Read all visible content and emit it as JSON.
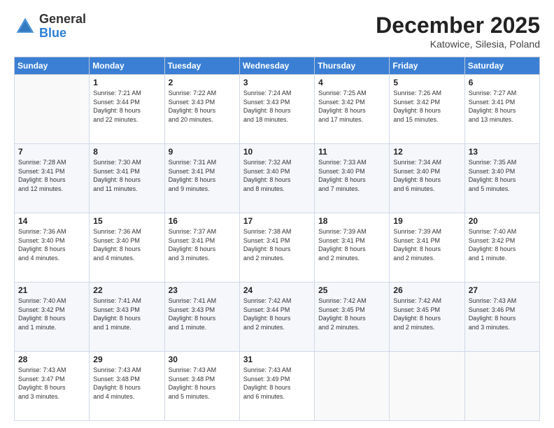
{
  "header": {
    "logo_general": "General",
    "logo_blue": "Blue",
    "month": "December 2025",
    "location": "Katowice, Silesia, Poland"
  },
  "days_of_week": [
    "Sunday",
    "Monday",
    "Tuesday",
    "Wednesday",
    "Thursday",
    "Friday",
    "Saturday"
  ],
  "weeks": [
    [
      {
        "day": "",
        "info": ""
      },
      {
        "day": "1",
        "info": "Sunrise: 7:21 AM\nSunset: 3:44 PM\nDaylight: 8 hours\nand 22 minutes."
      },
      {
        "day": "2",
        "info": "Sunrise: 7:22 AM\nSunset: 3:43 PM\nDaylight: 8 hours\nand 20 minutes."
      },
      {
        "day": "3",
        "info": "Sunrise: 7:24 AM\nSunset: 3:43 PM\nDaylight: 8 hours\nand 18 minutes."
      },
      {
        "day": "4",
        "info": "Sunrise: 7:25 AM\nSunset: 3:42 PM\nDaylight: 8 hours\nand 17 minutes."
      },
      {
        "day": "5",
        "info": "Sunrise: 7:26 AM\nSunset: 3:42 PM\nDaylight: 8 hours\nand 15 minutes."
      },
      {
        "day": "6",
        "info": "Sunrise: 7:27 AM\nSunset: 3:41 PM\nDaylight: 8 hours\nand 13 minutes."
      }
    ],
    [
      {
        "day": "7",
        "info": "Sunrise: 7:28 AM\nSunset: 3:41 PM\nDaylight: 8 hours\nand 12 minutes."
      },
      {
        "day": "8",
        "info": "Sunrise: 7:30 AM\nSunset: 3:41 PM\nDaylight: 8 hours\nand 11 minutes."
      },
      {
        "day": "9",
        "info": "Sunrise: 7:31 AM\nSunset: 3:41 PM\nDaylight: 8 hours\nand 9 minutes."
      },
      {
        "day": "10",
        "info": "Sunrise: 7:32 AM\nSunset: 3:40 PM\nDaylight: 8 hours\nand 8 minutes."
      },
      {
        "day": "11",
        "info": "Sunrise: 7:33 AM\nSunset: 3:40 PM\nDaylight: 8 hours\nand 7 minutes."
      },
      {
        "day": "12",
        "info": "Sunrise: 7:34 AM\nSunset: 3:40 PM\nDaylight: 8 hours\nand 6 minutes."
      },
      {
        "day": "13",
        "info": "Sunrise: 7:35 AM\nSunset: 3:40 PM\nDaylight: 8 hours\nand 5 minutes."
      }
    ],
    [
      {
        "day": "14",
        "info": "Sunrise: 7:36 AM\nSunset: 3:40 PM\nDaylight: 8 hours\nand 4 minutes."
      },
      {
        "day": "15",
        "info": "Sunrise: 7:36 AM\nSunset: 3:40 PM\nDaylight: 8 hours\nand 4 minutes."
      },
      {
        "day": "16",
        "info": "Sunrise: 7:37 AM\nSunset: 3:41 PM\nDaylight: 8 hours\nand 3 minutes."
      },
      {
        "day": "17",
        "info": "Sunrise: 7:38 AM\nSunset: 3:41 PM\nDaylight: 8 hours\nand 2 minutes."
      },
      {
        "day": "18",
        "info": "Sunrise: 7:39 AM\nSunset: 3:41 PM\nDaylight: 8 hours\nand 2 minutes."
      },
      {
        "day": "19",
        "info": "Sunrise: 7:39 AM\nSunset: 3:41 PM\nDaylight: 8 hours\nand 2 minutes."
      },
      {
        "day": "20",
        "info": "Sunrise: 7:40 AM\nSunset: 3:42 PM\nDaylight: 8 hours\nand 1 minute."
      }
    ],
    [
      {
        "day": "21",
        "info": "Sunrise: 7:40 AM\nSunset: 3:42 PM\nDaylight: 8 hours\nand 1 minute."
      },
      {
        "day": "22",
        "info": "Sunrise: 7:41 AM\nSunset: 3:43 PM\nDaylight: 8 hours\nand 1 minute."
      },
      {
        "day": "23",
        "info": "Sunrise: 7:41 AM\nSunset: 3:43 PM\nDaylight: 8 hours\nand 1 minute."
      },
      {
        "day": "24",
        "info": "Sunrise: 7:42 AM\nSunset: 3:44 PM\nDaylight: 8 hours\nand 2 minutes."
      },
      {
        "day": "25",
        "info": "Sunrise: 7:42 AM\nSunset: 3:45 PM\nDaylight: 8 hours\nand 2 minutes."
      },
      {
        "day": "26",
        "info": "Sunrise: 7:42 AM\nSunset: 3:45 PM\nDaylight: 8 hours\nand 2 minutes."
      },
      {
        "day": "27",
        "info": "Sunrise: 7:43 AM\nSunset: 3:46 PM\nDaylight: 8 hours\nand 3 minutes."
      }
    ],
    [
      {
        "day": "28",
        "info": "Sunrise: 7:43 AM\nSunset: 3:47 PM\nDaylight: 8 hours\nand 3 minutes."
      },
      {
        "day": "29",
        "info": "Sunrise: 7:43 AM\nSunset: 3:48 PM\nDaylight: 8 hours\nand 4 minutes."
      },
      {
        "day": "30",
        "info": "Sunrise: 7:43 AM\nSunset: 3:48 PM\nDaylight: 8 hours\nand 5 minutes."
      },
      {
        "day": "31",
        "info": "Sunrise: 7:43 AM\nSunset: 3:49 PM\nDaylight: 8 hours\nand 6 minutes."
      },
      {
        "day": "",
        "info": ""
      },
      {
        "day": "",
        "info": ""
      },
      {
        "day": "",
        "info": ""
      }
    ]
  ]
}
